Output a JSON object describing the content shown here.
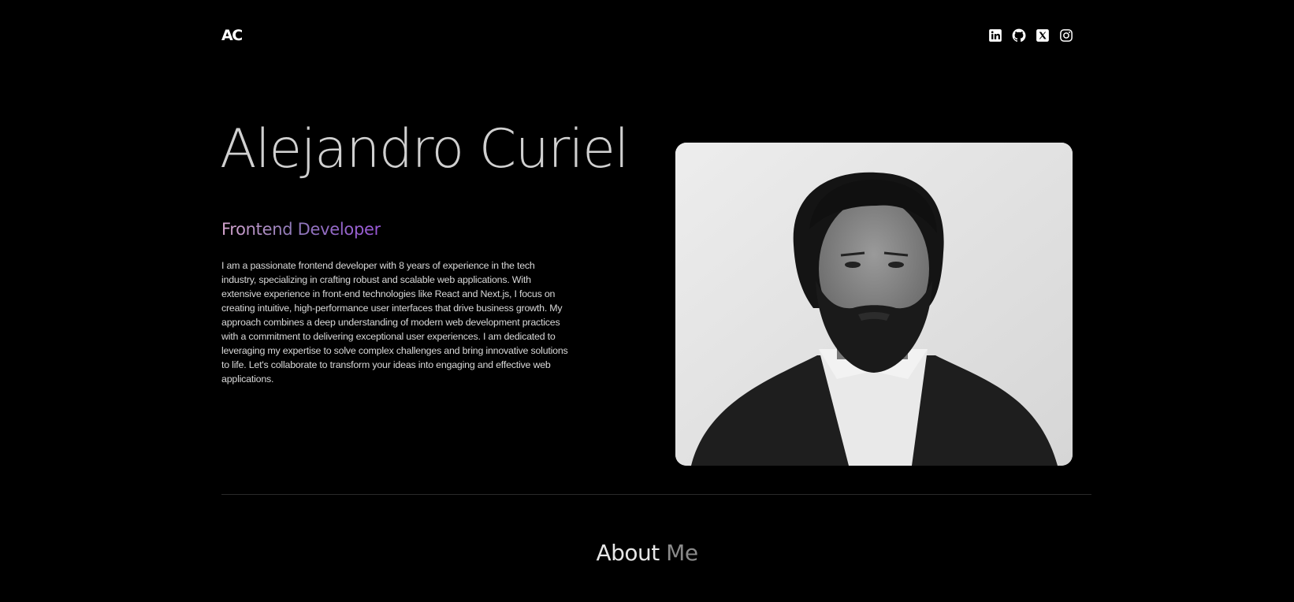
{
  "header": {
    "logo": "AC",
    "socials": [
      {
        "name": "LinkedIn",
        "icon": "linkedin-icon"
      },
      {
        "name": "GitHub",
        "icon": "github-icon"
      },
      {
        "name": "X",
        "icon": "x-icon"
      },
      {
        "name": "Instagram",
        "icon": "instagram-icon"
      }
    ]
  },
  "hero": {
    "name": "Alejandro Curiel",
    "role": "Frontend Developer",
    "bio": "I am a passionate frontend developer with 8 years of experience in the tech industry, specializing in crafting robust and scalable web applications. With extensive experience in front-end technologies like React and Next.js, I focus on creating intuitive, high-performance user interfaces that drive business growth. My approach combines a deep understanding of modern web development practices with a commitment to delivering exceptional user experiences. I am dedicated to leveraging my expertise to solve complex challenges and bring innovative solutions to life. Let's collaborate to transform your ideas into engaging and effective web applications."
  },
  "about": {
    "title_strong": "About",
    "title_muted": "Me"
  },
  "colors": {
    "background": "#000000",
    "gradient_start": "#d7a6d0",
    "gradient_end": "#9a56d8"
  }
}
